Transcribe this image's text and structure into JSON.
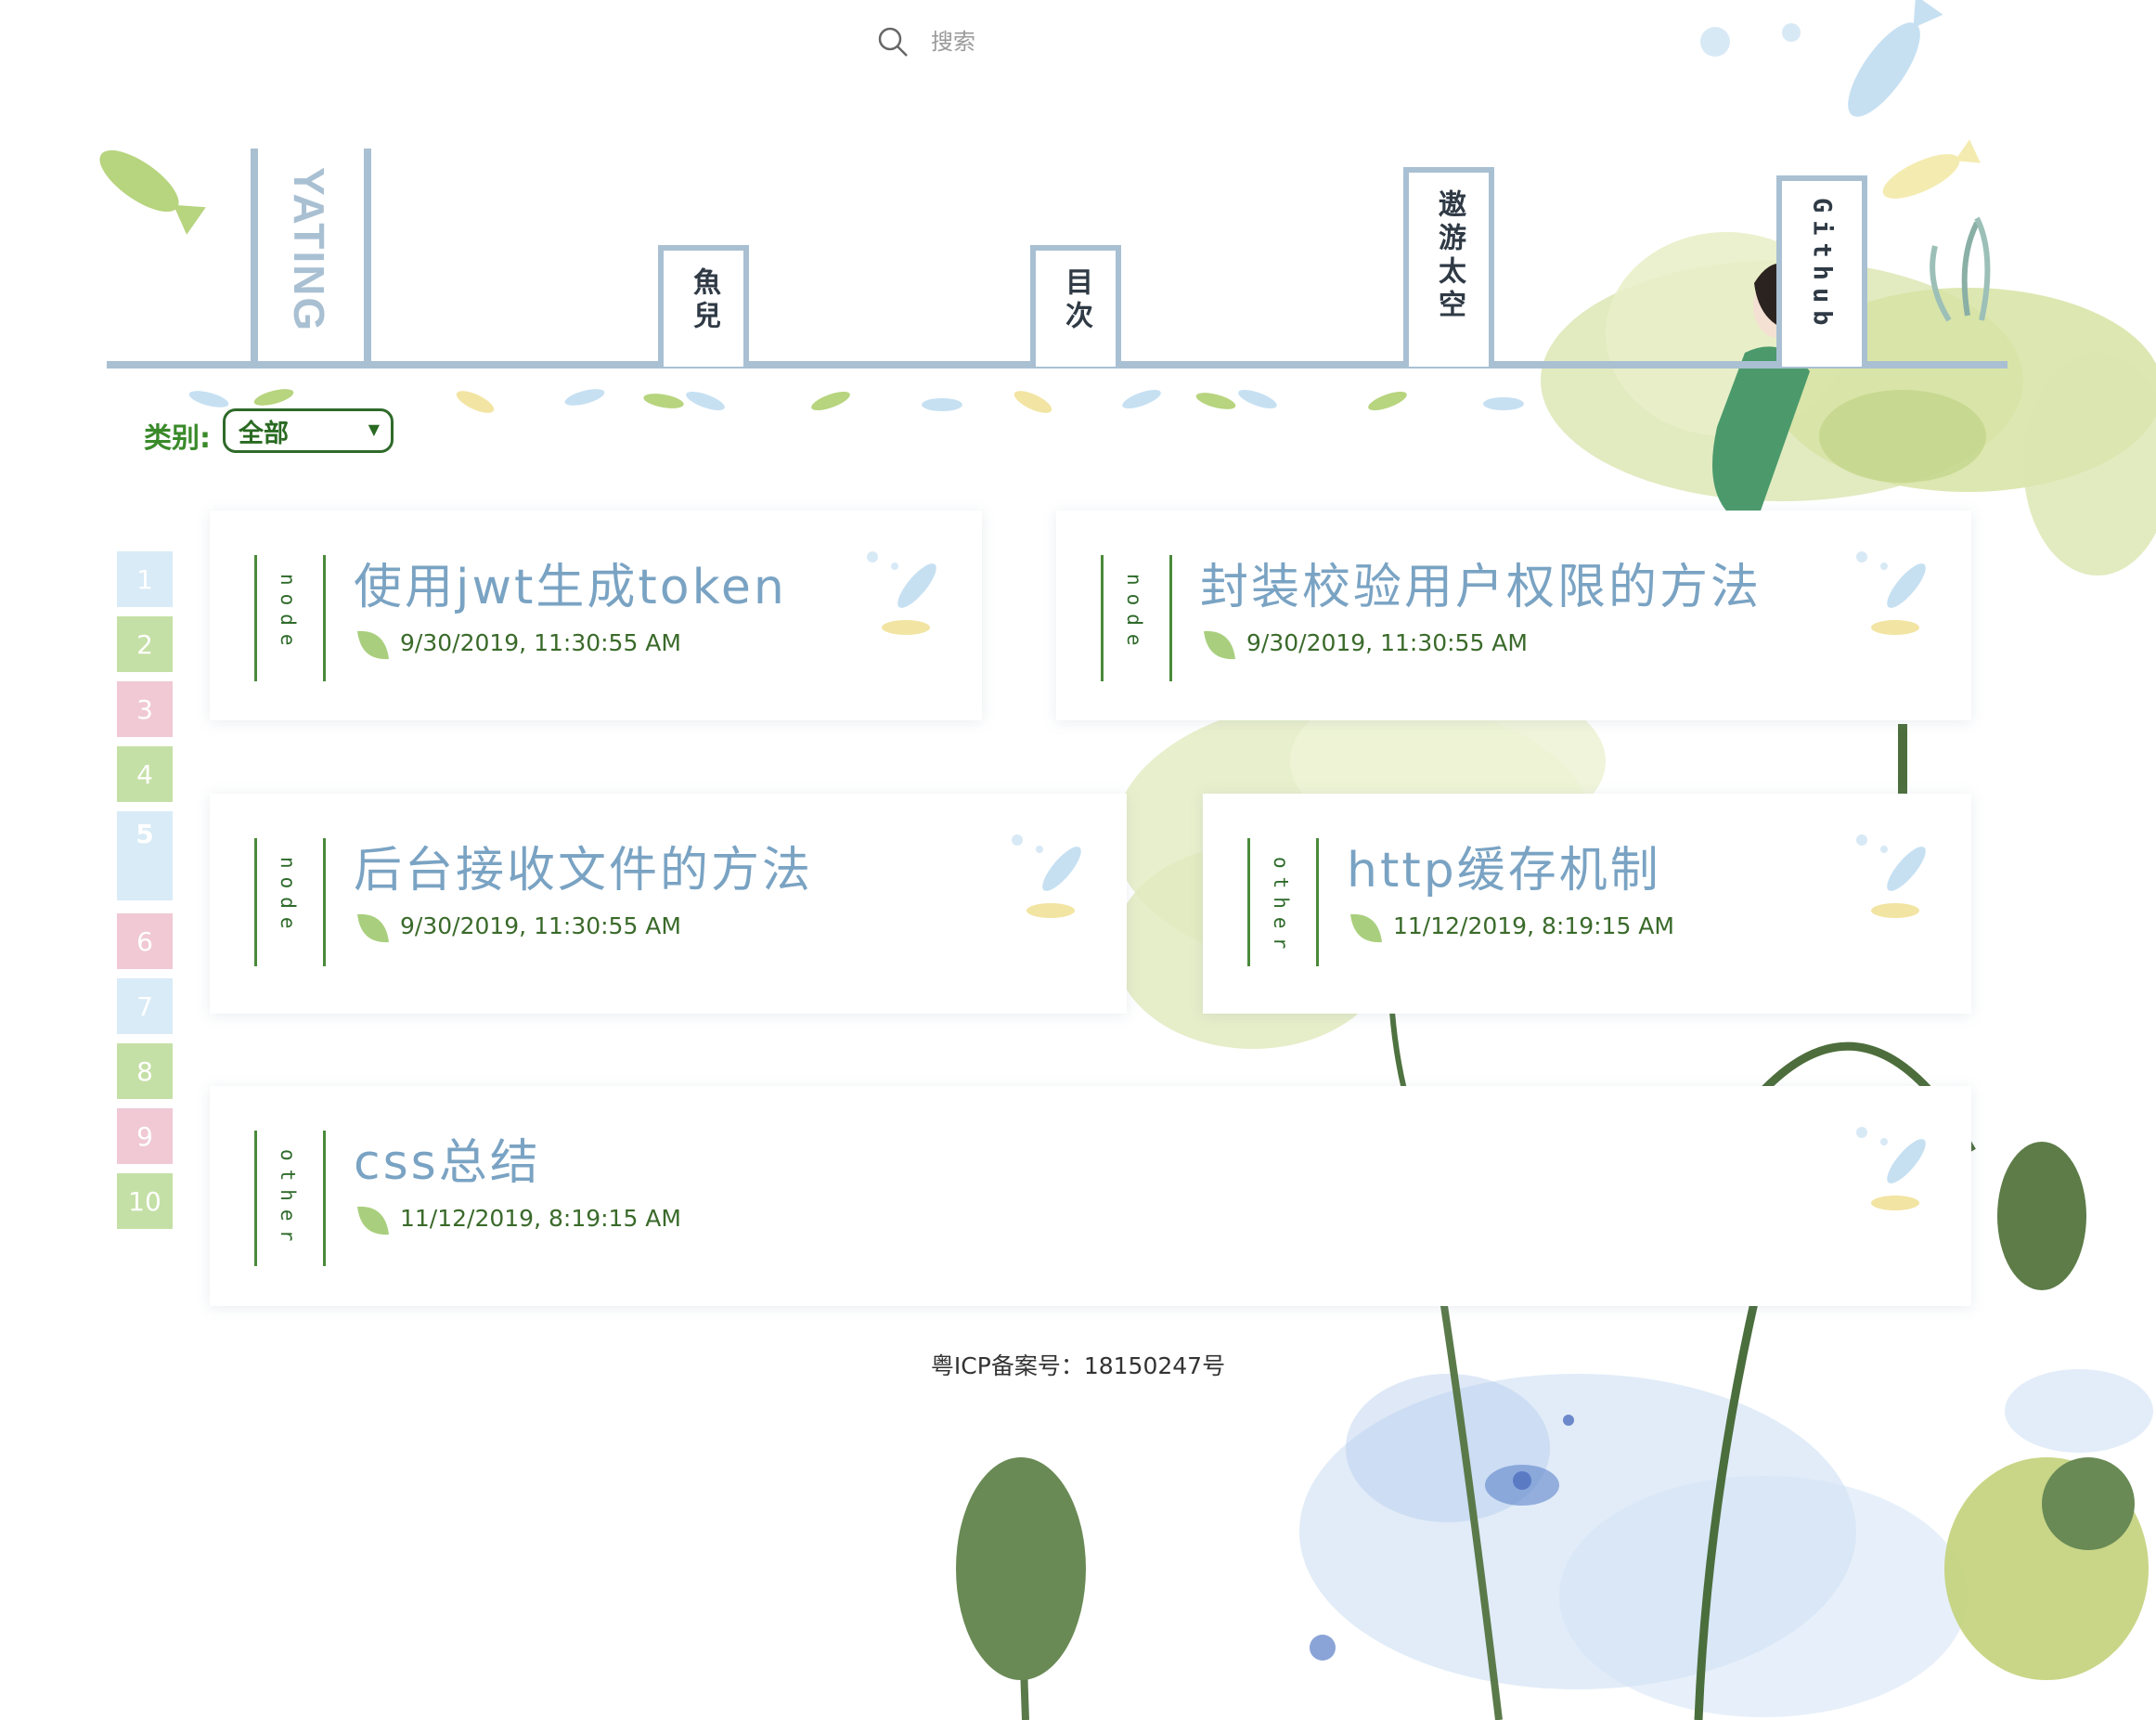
{
  "search": {
    "placeholder": "搜索"
  },
  "logo": {
    "text": "YATING"
  },
  "nav": {
    "items": [
      {
        "label": "魚兒"
      },
      {
        "label": "目次"
      },
      {
        "label": "遨游太空"
      },
      {
        "label": "Github"
      }
    ]
  },
  "category": {
    "label": "类别:",
    "selected": "全部"
  },
  "pagination": {
    "pages": [
      "1",
      "2",
      "3",
      "4",
      "5",
      "6",
      "7",
      "8",
      "9",
      "10"
    ],
    "current": "5",
    "colors": [
      "#d8ebf7",
      "#c5e0a6",
      "#f0c9d5",
      "#c5e0a6",
      "#d8ebf7",
      "#f0c9d5",
      "#d8ebf7",
      "#c5e0a6",
      "#f0c9d5",
      "#c5e0a6"
    ]
  },
  "posts": [
    {
      "tag": "node",
      "title": "使用jwt生成token",
      "date": "9/30/2019, 11:30:55 AM"
    },
    {
      "tag": "node",
      "title": "封装校验用户权限的方法",
      "date": "9/30/2019, 11:30:55 AM"
    },
    {
      "tag": "node",
      "title": "后台接收文件的方法",
      "date": "9/30/2019, 11:30:55 AM"
    },
    {
      "tag": "other",
      "title": "http缓存机制",
      "date": "11/12/2019, 8:19:15 AM"
    },
    {
      "tag": "other",
      "title": "css总结",
      "date": "11/12/2019, 8:19:15 AM"
    }
  ],
  "footer": {
    "icp": "粤ICP备案号：18150247号"
  },
  "colors": {
    "nav_line": "#a9c0d3",
    "title_blue": "#7aa3c3",
    "green_text": "#3a6a2a"
  }
}
